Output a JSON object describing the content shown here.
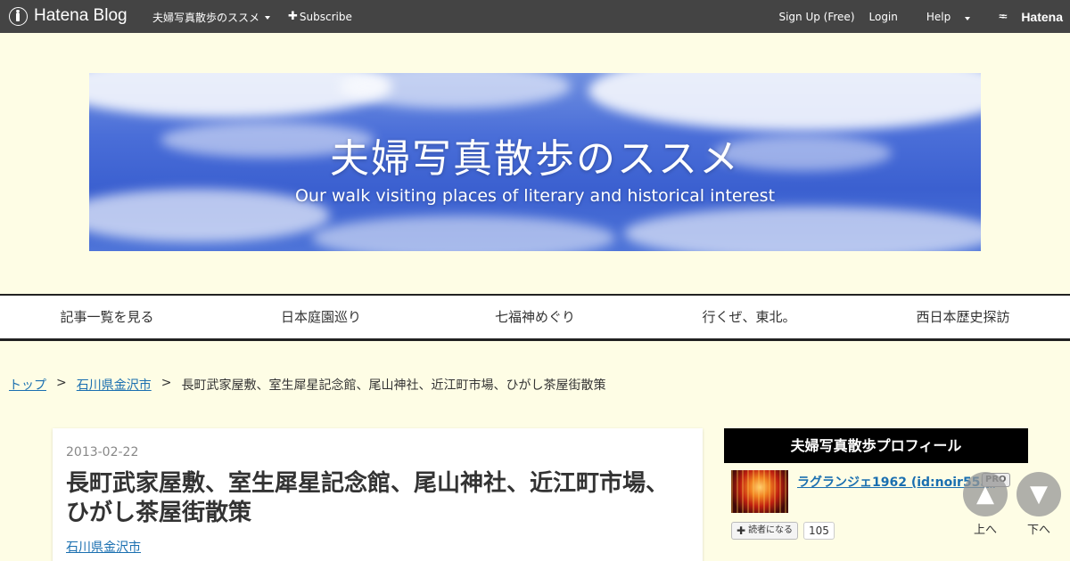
{
  "topbar": {
    "logo_text": "Hatena Blog",
    "blog_name": "夫婦写真散歩のススメ",
    "subscribe": "Subscribe",
    "signup": "Sign Up (Free)",
    "login": "Login",
    "help": "Help",
    "hatena": "Hatena"
  },
  "header": {
    "title": "夫婦写真散歩のススメ",
    "subtitle": "Our walk visiting places of literary and historical interest"
  },
  "global_nav": {
    "items": [
      {
        "label": "記事一覧を見る"
      },
      {
        "label": "日本庭園巡り"
      },
      {
        "label": "七福神めぐり"
      },
      {
        "label": "行くぜ、東北。"
      },
      {
        "label": "西日本歴史探訪"
      }
    ]
  },
  "breadcrumb": {
    "top": "トップ",
    "sep": ">",
    "category": "石川県金沢市",
    "current": "長町武家屋敷、室生犀星記念館、尾山神社、近江町市場、ひがし茶屋街散策"
  },
  "article": {
    "date": "2013-02-22",
    "title": "長町武家屋敷、室生犀星記念館、尾山神社、近江町市場、ひがし茶屋街散策",
    "category": "石川県金沢市"
  },
  "sidebar": {
    "profile_heading": "夫婦写真散歩プロフィール",
    "user_name": "ラグランジェ1962 (id:noir555)",
    "pro_badge": "PRO",
    "subscribe_label": "読者になる",
    "subscriber_count": "105"
  },
  "page_nav": {
    "up_arrow": "▲",
    "up_label": "上へ",
    "down_arrow": "▼",
    "down_label": "下へ"
  }
}
